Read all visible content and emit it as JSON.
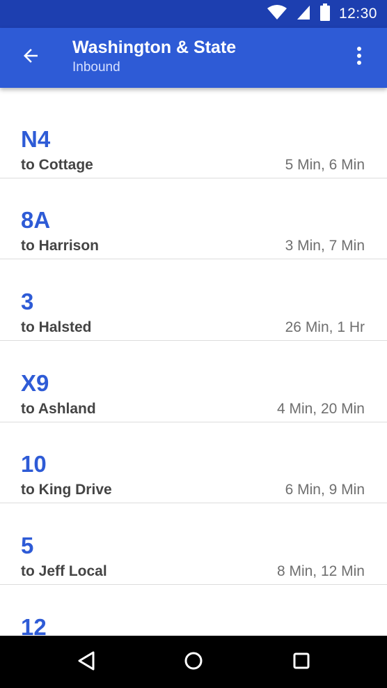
{
  "status_bar": {
    "time": "12:30",
    "icons": [
      "wifi-icon",
      "signal-icon",
      "battery-icon"
    ]
  },
  "app_bar": {
    "title": "Washington & State",
    "subtitle": "Inbound",
    "back_icon": "arrow-back-icon",
    "menu_icon": "more-vert-icon"
  },
  "colors": {
    "status_bar": "#1d3fb0",
    "app_bar": "#2e5bd6",
    "route_text": "#2e5bd6",
    "destination_text": "#444444",
    "times_text": "#6f6f6f",
    "nav_bar": "#000000"
  },
  "arrivals": [
    {
      "route": "N4",
      "destination": "to Cottage",
      "times": "5 Min, 6 Min"
    },
    {
      "route": "8A",
      "destination": "to Harrison",
      "times": "3 Min, 7 Min"
    },
    {
      "route": "3",
      "destination": "to Halsted",
      "times": "26 Min, 1 Hr"
    },
    {
      "route": "X9",
      "destination": "to Ashland",
      "times": "4 Min, 20 Min"
    },
    {
      "route": "10",
      "destination": "to King Drive",
      "times": "6 Min, 9 Min"
    },
    {
      "route": "5",
      "destination": "to Jeff Local",
      "times": "8 Min, 12 Min"
    },
    {
      "route": "12",
      "destination": "",
      "times": ""
    }
  ],
  "nav_bar": {
    "buttons": [
      "back-triangle-icon",
      "home-circle-icon",
      "recents-square-icon"
    ]
  }
}
